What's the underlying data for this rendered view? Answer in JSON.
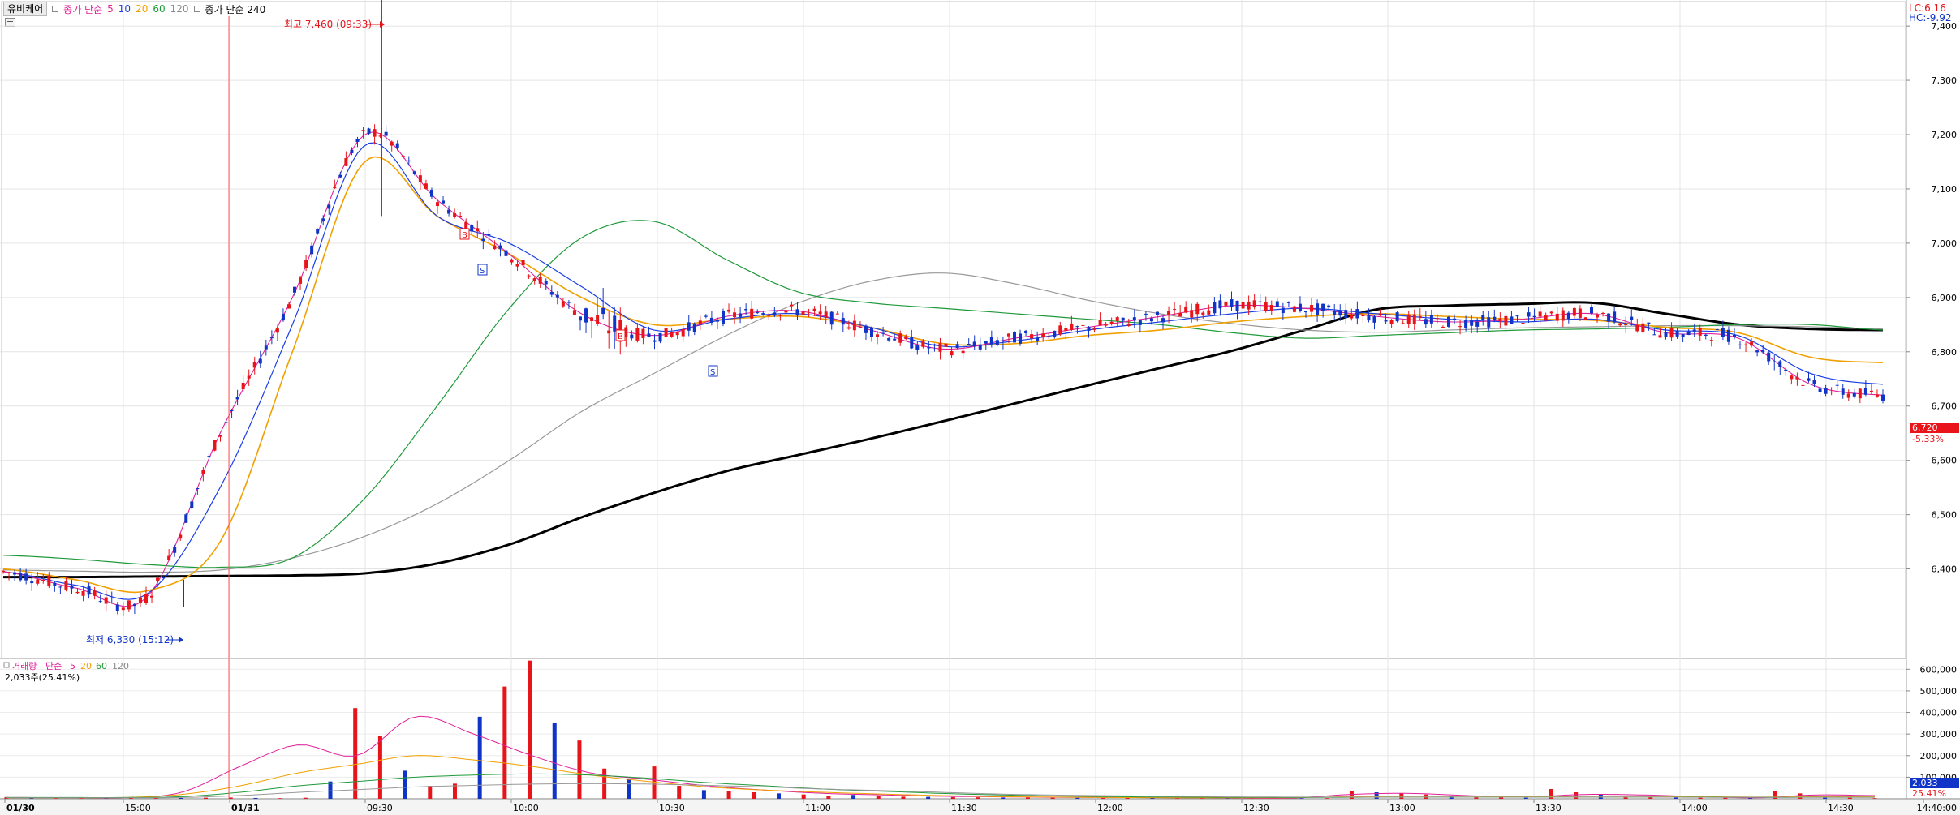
{
  "header": {
    "stock_tab": "유비케어",
    "ma_label": "종가 단순",
    "ma_periods": [
      "5",
      "10",
      "20",
      "60",
      "120"
    ],
    "ma_long_label": "종가 단순 240",
    "colors": {
      "ma5": "#e0209a",
      "ma10": "#1a3ee6",
      "ma20": "#f0a000",
      "ma60": "#1f9a3a",
      "ma120": "#999999",
      "ma240": "#000000",
      "up": "#e8141a",
      "down": "#1034c8"
    }
  },
  "right_info": {
    "lc": "LC:6.16",
    "hc": "HC:-9.92"
  },
  "price_tag": {
    "value": "6,720",
    "change": "-5.33%"
  },
  "annotations": {
    "high": "최고 7,460 (09:33)",
    "low": "최저 6,330 (15:12)",
    "markers": [
      "B",
      "S",
      "B",
      "S"
    ]
  },
  "volume_header": {
    "label": "거래량",
    "ma_label": "단순",
    "ma_periods": [
      "5",
      "20",
      "60",
      "120"
    ],
    "value": "2,033주(25.41%)"
  },
  "volume_tag": {
    "value": "2,033",
    "pct": "25.41%"
  },
  "chart_data": [
    {
      "type": "line",
      "title": "유비케어",
      "y_ticks": [
        6400,
        6500,
        6600,
        6700,
        6800,
        6900,
        7000,
        7100,
        7200,
        7300,
        7400
      ],
      "y_tick_labels": [
        "6,400",
        "6,500",
        "6,600",
        "6,700",
        "6,800",
        "6,900",
        "7,000",
        "7,100",
        "7,200",
        "7,300",
        "7,400"
      ],
      "ylim": [
        6235,
        7445
      ],
      "x_labels": [
        "01/30",
        "15:00",
        "01/31",
        "09:30",
        "10:00",
        "10:30",
        "11:00",
        "11:30",
        "12:00",
        "12:30",
        "13:00",
        "13:30",
        "14:00",
        "14:30",
        "14:40:00"
      ],
      "high": 7460,
      "low": 6330,
      "last": 6720,
      "series": [
        {
          "name": "종가 단순 240",
          "values": [
            6385,
            6385,
            6386,
            6387,
            6388,
            6392,
            6410,
            6445,
            6495,
            6540,
            6580,
            6610,
            6640,
            6672,
            6705,
            6738,
            6770,
            6802,
            6840,
            6878,
            6885,
            6888,
            6890,
            6870,
            6850,
            6842,
            6840
          ]
        },
        {
          "name": "120",
          "values": [
            6398,
            6396,
            6394,
            6398,
            6420,
            6460,
            6520,
            6600,
            6690,
            6760,
            6830,
            6890,
            6930,
            6945,
            6925,
            6895,
            6870,
            6852,
            6840,
            6836,
            6840,
            6844,
            6846,
            6848,
            6848,
            6846,
            6842
          ]
        },
        {
          "name": "60",
          "values": [
            6425,
            6418,
            6408,
            6403,
            6420,
            6530,
            6700,
            6880,
            7010,
            7040,
            6970,
            6910,
            6890,
            6880,
            6870,
            6860,
            6850,
            6835,
            6825,
            6830,
            6835,
            6840,
            6842,
            6845,
            6850,
            6850,
            6840
          ]
        },
        {
          "name": "20",
          "values": [
            6400,
            6380,
            6360,
            6450,
            6800,
            7150,
            7050,
            6980,
            6900,
            6850,
            6860,
            6865,
            6845,
            6815,
            6815,
            6830,
            6840,
            6855,
            6865,
            6870,
            6865,
            6860,
            6858,
            6845,
            6835,
            6790,
            6780
          ]
        },
        {
          "name": "10",
          "values": [
            6395,
            6370,
            6355,
            6550,
            6850,
            7180,
            7050,
            7000,
            6920,
            6840,
            6860,
            6870,
            6845,
            6810,
            6820,
            6840,
            6855,
            6870,
            6880,
            6870,
            6860,
            6855,
            6860,
            6840,
            6830,
            6760,
            6740
          ]
        },
        {
          "name": "5",
          "values": [
            6395,
            6365,
            6350,
            6650,
            6900,
            7200,
            7080,
            6980,
            6870,
            6830,
            6865,
            6875,
            6840,
            6805,
            6825,
            6845,
            6865,
            6885,
            6880,
            6865,
            6855,
            6860,
            6870,
            6835,
            6825,
            6740,
            6720
          ]
        }
      ]
    },
    {
      "type": "bar",
      "title": "거래량",
      "y_ticks": [
        100000,
        200000,
        300000,
        400000,
        500000,
        600000
      ],
      "y_tick_labels": [
        "100,000",
        "200,000",
        "300,000",
        "400,000",
        "500,000",
        "600,000"
      ],
      "ylim": [
        0,
        650000
      ],
      "values": [
        8000,
        5000,
        4000,
        6000,
        3000,
        5000,
        7000,
        4000,
        5000,
        6000,
        4000,
        3000,
        5000,
        80000,
        420000,
        290000,
        130000,
        60000,
        70000,
        380000,
        520000,
        640000,
        350000,
        270000,
        140000,
        90000,
        150000,
        60000,
        40000,
        35000,
        30000,
        25000,
        20000,
        15000,
        18000,
        12000,
        10000,
        9000,
        8000,
        7000,
        6000,
        6000,
        5000,
        5000,
        4000,
        4000,
        4000,
        3000,
        3000,
        3000,
        4000,
        3000,
        3000,
        3000,
        35000,
        30000,
        25000,
        20000,
        15000,
        10000,
        8000,
        5000,
        45000,
        30000,
        20000,
        10000,
        8000,
        6000,
        5000,
        5000,
        4000,
        35000,
        25000,
        15000,
        5000,
        3000
      ],
      "series": [
        {
          "name": "5",
          "values": [
            6000,
            5500,
            5000,
            30000,
            150000,
            250000,
            200000,
            380000,
            300000,
            200000,
            120000,
            90000,
            60000,
            40000,
            25000,
            18000,
            12000,
            9000,
            7000,
            6000,
            5000,
            4000,
            3000,
            20000,
            25000,
            15000,
            8000,
            20000,
            18000,
            10000,
            5000,
            18000,
            15000
          ]
        },
        {
          "name": "20",
          "values": [
            5000,
            5000,
            6000,
            20000,
            60000,
            120000,
            160000,
            200000,
            180000,
            150000,
            110000,
            80000,
            55000,
            40000,
            30000,
            22000,
            15000,
            10000,
            8000,
            6000,
            5000,
            5000,
            5000,
            10000,
            12000,
            12000,
            10000,
            12000,
            12000,
            10000,
            8000,
            10000,
            10000
          ]
        },
        {
          "name": "60",
          "values": [
            6000,
            6000,
            6000,
            10000,
            30000,
            60000,
            80000,
            100000,
            110000,
            115000,
            110000,
            95000,
            75000,
            60000,
            45000,
            35000,
            25000,
            18000,
            13000,
            10000,
            8000,
            7000,
            6000,
            7000,
            8000,
            8000,
            8000,
            8000,
            8000,
            8000,
            7000,
            7000,
            7000
          ]
        },
        {
          "name": "120",
          "values": [
            5000,
            5000,
            5000,
            6000,
            15000,
            30000,
            42000,
            55000,
            62000,
            68000,
            70000,
            68000,
            62000,
            55000,
            45000,
            38000,
            30000,
            22000,
            17000,
            14000,
            11000,
            9000,
            8000,
            8000,
            8000,
            8000,
            8000,
            8000,
            8000,
            7000,
            7000,
            7000,
            7000
          ]
        }
      ]
    }
  ]
}
